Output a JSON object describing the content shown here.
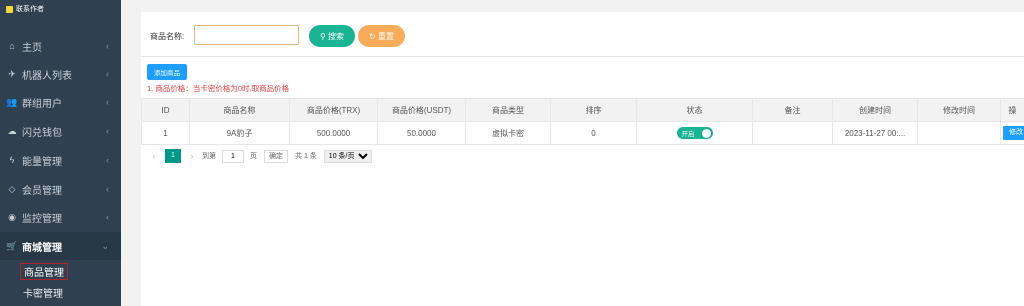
{
  "sidebar": {
    "top_label": "联系作者",
    "items": [
      {
        "label": "主页",
        "icon": "home-icon",
        "glyph": "⌂"
      },
      {
        "label": "机器人列表",
        "icon": "paper-plane-icon",
        "glyph": "✈"
      },
      {
        "label": "群组用户",
        "icon": "users-icon",
        "glyph": "👥"
      },
      {
        "label": "闪兑钱包",
        "icon": "cloud-icon",
        "glyph": "☁"
      },
      {
        "label": "能量管理",
        "icon": "bolt-icon",
        "glyph": "ϟ"
      },
      {
        "label": "会员管理",
        "icon": "diamond-icon",
        "glyph": "◇"
      },
      {
        "label": "监控管理",
        "icon": "eye-icon",
        "glyph": "◉"
      },
      {
        "label": "商城管理",
        "icon": "cart-icon",
        "glyph": "🛒"
      }
    ],
    "subitems": [
      {
        "label": "商品管理"
      },
      {
        "label": "卡密管理"
      }
    ]
  },
  "search": {
    "label": "商品名称:",
    "value": "",
    "search_button": "搜索",
    "reset_button": "重置"
  },
  "toolbar": {
    "add_button": "添加商品",
    "note": "1. 商品价格：当卡密价格为0时,取商品价格"
  },
  "table": {
    "headers": [
      "ID",
      "商品名称",
      "商品价格(TRX)",
      "商品价格(USDT)",
      "商品类型",
      "排序",
      "状态",
      "备注",
      "创建时间",
      "修改时间",
      "操"
    ],
    "rows": [
      {
        "id": "1",
        "name": "9A豹子",
        "price_trx": "500.0000",
        "price_usdt": "50.0000",
        "type": "虚拟卡密",
        "sort": "0",
        "status": "开启",
        "remark": "",
        "created": "2023-11-27 00:...",
        "modified": "",
        "action": "修改"
      }
    ]
  },
  "pager": {
    "prev": "‹",
    "current": "1",
    "next": "›",
    "goto_label": "到第",
    "goto_value": "1",
    "page_unit": "页",
    "confirm": "确定",
    "total": "共 1 条",
    "page_size": "10 条/页"
  },
  "colors": {
    "sidebar_bg": "#2f4050",
    "primary_green": "#1ab394",
    "warning_orange": "#f8ac59",
    "blue_button": "#1e9fff",
    "note_red": "#e4393c",
    "pager_teal": "#009688"
  }
}
